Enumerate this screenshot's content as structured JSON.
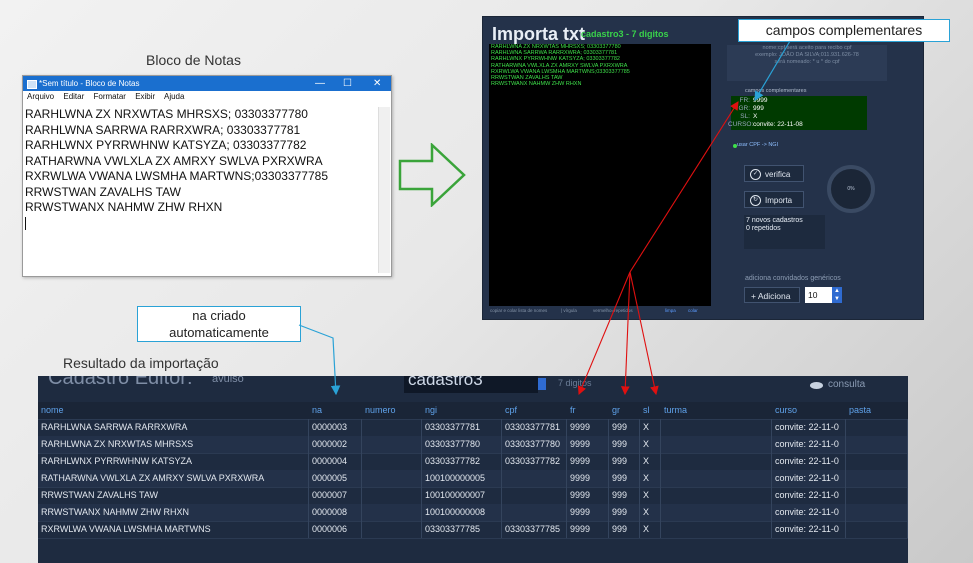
{
  "captions": {
    "notepad": "Bloco de Notas",
    "result": "Resultado da importação"
  },
  "notepad": {
    "title": "*Sem título - Bloco de Notas",
    "controls": [
      "—",
      "☐",
      "✕"
    ],
    "menu": [
      "Arquivo",
      "Editar",
      "Formatar",
      "Exibir",
      "Ajuda"
    ],
    "lines": [
      "RARHLWNA ZX NRXWTAS MHRSXS; 03303377780",
      "RARHLWNA SARRWA RARRXWRA; 03303377781",
      "RARHLWNX PYRRWHNW KATSYZA; 03303377782",
      "RATHARWNA VWLXLA ZX AMRXY SWLVA PXRXWRA",
      "RXRWLWA VWANA LWSMHA MARTWNS;03303377785",
      "RRWSTWAN ZAVALHS TAW",
      "RRWSTWANX NAHMW ZHW RHXN"
    ]
  },
  "importa": {
    "title": "Importa txt",
    "subtitle": "cadastro3 - 7 digitos",
    "console_lines": [
      "RARHLWNA ZX NRXWTAS MHRSXS; 03303377780",
      "RARHLWNA SARRWA RARRXWRA; 03303377781",
      "RARHLWNX PYRRWHNW KATSYZA; 03303377782",
      "RATHARWNA VWLXLA ZX AMRXY SWLVA PXRXWRA",
      "RXRWLWA VWANA LWSMHA MARTWNS;03303377785",
      "RRWSTWAN ZAVALHS TAW",
      "RRWSTWANX NAHMW ZHW RHXN"
    ],
    "footer": [
      "copiar e colar lista de nomes",
      "| vírgula",
      "vermelho=repetidos"
    ],
    "footer_links": [
      "limpa",
      "colar"
    ],
    "note_lines": [
      "nome;cpf   será aceito para recibo cpf",
      "exemplo:  JOÃO DA SILVA;011.931.626-78",
      "será nomeado: * u * do cpf"
    ],
    "cc_label": "campos complementares",
    "cc_fields": [
      {
        "key": "FR:",
        "value": "9999"
      },
      {
        "key": "GR:",
        "value": "999"
      },
      {
        "key": "SL:",
        "value": "X"
      },
      {
        "key": "CURSO:",
        "value": "convite: 22-11-08"
      }
    ],
    "cpf_option": "usar CPF -> NGI",
    "btn_verifica": "verifica",
    "btn_importa": "Importa",
    "gauge": "0%",
    "status": [
      "7 novos cadastros",
      "0 repetidos"
    ],
    "generic_label": "adiciona convidados genéricos",
    "add_label": "Adiciona",
    "add_qty": "10"
  },
  "callouts": {
    "campos": "campos complementares",
    "na_criado": [
      "na criado",
      "automaticamente"
    ]
  },
  "cadastro": {
    "title": "Cadastro Editor:",
    "title_suffix": "avulso",
    "selected": "cadastro3",
    "subtitle": "7 digitos",
    "consulta": "consulta",
    "headers": [
      "nome",
      "na",
      "numero",
      "ngi",
      "cpf",
      "fr",
      "gr",
      "sl",
      "turma",
      "curso",
      "pasta"
    ],
    "rows": [
      [
        "RARHLWNA SARRWA RARRXWRA",
        "0000003",
        "",
        "03303377781",
        "03303377781",
        "9999",
        "999",
        "X",
        "",
        "convite: 22-11-0",
        ""
      ],
      [
        "RARHLWNA ZX NRXWTAS MHRSXS",
        "0000002",
        "",
        "03303377780",
        "03303377780",
        "9999",
        "999",
        "X",
        "",
        "convite: 22-11-0",
        ""
      ],
      [
        "RARHLWNX PYRRWHNW KATSYZA",
        "0000004",
        "",
        "03303377782",
        "03303377782",
        "9999",
        "999",
        "X",
        "",
        "convite: 22-11-0",
        ""
      ],
      [
        "RATHARWNA VWLXLA ZX AMRXY SWLVA PXRXWRA",
        "0000005",
        "",
        "100100000005",
        "",
        "9999",
        "999",
        "X",
        "",
        "convite: 22-11-0",
        ""
      ],
      [
        "RRWSTWAN ZAVALHS TAW",
        "0000007",
        "",
        "100100000007",
        "",
        "9999",
        "999",
        "X",
        "",
        "convite: 22-11-0",
        ""
      ],
      [
        "RRWSTWANX NAHMW ZHW RHXN",
        "0000008",
        "",
        "100100000008",
        "",
        "9999",
        "999",
        "X",
        "",
        "convite: 22-11-0",
        ""
      ],
      [
        "RXRWLWA VWANA LWSMHA MARTWNS",
        "0000006",
        "",
        "03303377785",
        "03303377785",
        "9999",
        "999",
        "X",
        "",
        "convite: 22-11-0",
        ""
      ]
    ]
  },
  "colors": {
    "callout_border": "#2aa2d6",
    "arrow_red": "#e01010",
    "console_green": "#3ee04a",
    "header_blue": "#5fa2ea",
    "arrow_green": "#3aa43a"
  }
}
